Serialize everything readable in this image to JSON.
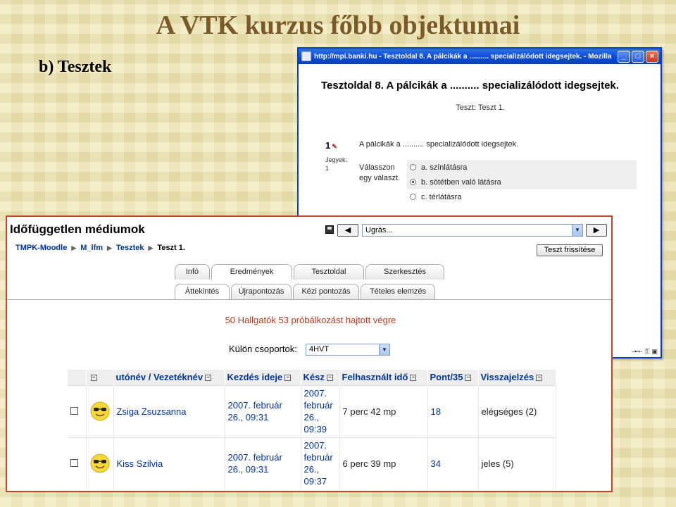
{
  "slide": {
    "title": "A VTK kurzus főbb objektumai",
    "subtitle": "b) Tesztek"
  },
  "browser_window": {
    "title": "http://mpi.banki.hu - Tesztoldal 8. A pálcikák a .......... specializálódott idegsejtek. - Mozilla",
    "controls": [
      "_",
      "□",
      "×"
    ],
    "heading": "Tesztoldal 8. A pálcikák a .......... specializálódott idegsejtek.",
    "sub": "Teszt: Teszt 1.",
    "question": {
      "number": "1",
      "grade_label": "Jegyek:",
      "grade_value": "1",
      "text": "A pálcikák a .......... specializálódott idegsejtek.",
      "prompt": "Válasszon egy választ.",
      "options": [
        {
          "label": "a. színlátásra",
          "checked": false
        },
        {
          "label": "b. sötétben való látásra",
          "checked": true
        },
        {
          "label": "c. térlátásra",
          "checked": false
        }
      ]
    }
  },
  "moodle": {
    "page_title": "Időfüggetlen médiumok",
    "jump_select": "Ugrás...",
    "prev_label": "◀",
    "next_label": "▶",
    "breadcrumb": [
      "TMPK-Moodle",
      "M_lfm",
      "Tesztek",
      "Teszt 1."
    ],
    "update_button": "Teszt frissítése",
    "tabs_row1": [
      "Infó",
      "Eredmények",
      "Tesztoldal",
      "Szerkesztés"
    ],
    "tabs_row2": [
      "Áttekintés",
      "Újrapontozás",
      "Kézi pontozás",
      "Tételes elemzés"
    ],
    "summary": "50 Hallgatók 53 próbálkozást hajtott végre",
    "group_label": "Külön csoportok:",
    "group_value": "4HVT",
    "columns": [
      "",
      "",
      "utónév / Vezetéknév",
      "Kezdés ideje",
      "Kész",
      "Felhasznált idő",
      "Pont/35",
      "Visszajelzés"
    ],
    "rows": [
      {
        "name": "Zsiga Zsuzsanna",
        "start": "2007. február 26., 09:31",
        "done": "2007. február 26., 09:39",
        "time": "7 perc 42 mp",
        "score": "18",
        "feedback": "elégséges (2)"
      },
      {
        "name": "Kiss Szilvia",
        "start": "2007. február 26., 09:31",
        "done": "2007. február 26., 09:37",
        "time": "6 perc 39 mp",
        "score": "34",
        "feedback": "jeles (5)"
      }
    ]
  }
}
